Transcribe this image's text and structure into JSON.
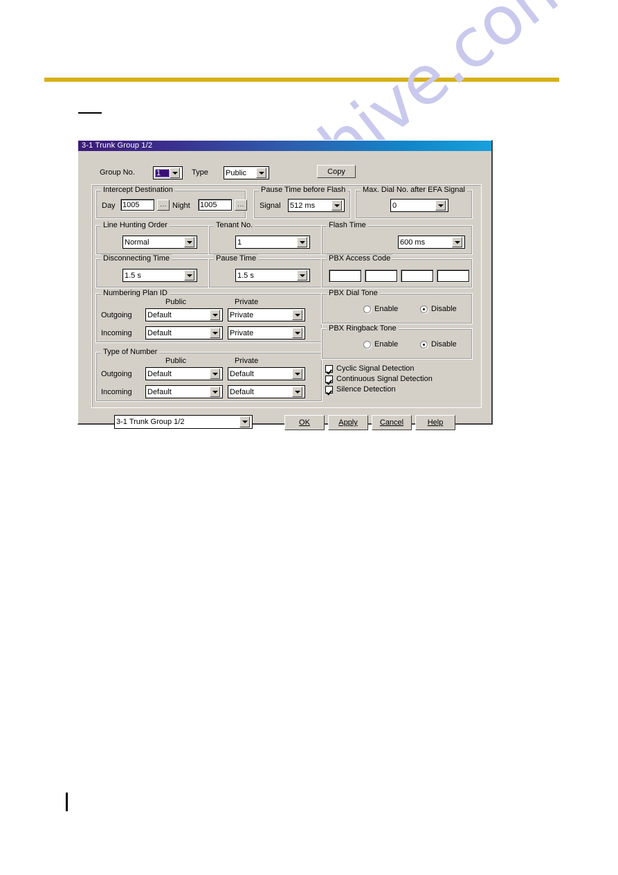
{
  "page": {
    "watermark": "manualshive.com"
  },
  "dialog": {
    "title": "3-1 Trunk Group 1/2",
    "group_no_label": "Group No.",
    "group_no_value": "1",
    "type_label": "Type",
    "type_value": "Public",
    "copy_button": "Copy",
    "intercept": {
      "legend": "Intercept Destination",
      "day_label": "Day",
      "day_value": "1005",
      "day_browse": "...",
      "night_label": "Night",
      "night_value": "1005",
      "night_browse": "..."
    },
    "pause_before_flash": {
      "legend": "Pause Time before Flash",
      "signal_label": "Signal",
      "signal_value": "512 ms"
    },
    "max_dial_efa": {
      "legend": "Max. Dial No. after EFA Signal",
      "value": "0"
    },
    "line_hunting": {
      "legend": "Line Hunting Order",
      "value": "Normal"
    },
    "tenant_no": {
      "legend": "Tenant No.",
      "value": "1"
    },
    "flash_time": {
      "legend": "Flash Time",
      "value": "600 ms"
    },
    "disconnecting_time": {
      "legend": "Disconnecting Time",
      "value": "1.5 s"
    },
    "pause_time": {
      "legend": "Pause Time",
      "value": "1.5 s"
    },
    "pbx_access_code": {
      "legend": "PBX Access Code",
      "values": [
        "",
        "",
        "",
        ""
      ]
    },
    "numbering_plan_id": {
      "legend": "Numbering Plan ID",
      "col_public": "Public",
      "col_private": "Private",
      "row_outgoing": "Outgoing",
      "row_incoming": "Incoming",
      "outgoing_public": "Default",
      "outgoing_private": "Private",
      "incoming_public": "Default",
      "incoming_private": "Private"
    },
    "type_of_number": {
      "legend": "Type of Number",
      "col_public": "Public",
      "col_private": "Private",
      "row_outgoing": "Outgoing",
      "row_incoming": "Incoming",
      "outgoing_public": "Default",
      "outgoing_private": "Default",
      "incoming_public": "Default",
      "incoming_private": "Default"
    },
    "pbx_dial_tone": {
      "legend": "PBX Dial Tone",
      "enable_label": "Enable",
      "disable_label": "Disable",
      "selected": "Disable"
    },
    "pbx_ringback_tone": {
      "legend": "PBX Ringback Tone",
      "enable_label": "Enable",
      "disable_label": "Disable",
      "selected": "Disable"
    },
    "detections": [
      {
        "label": "Cyclic Signal Detection",
        "checked": true
      },
      {
        "label": "Continuous Signal Detection",
        "checked": true
      },
      {
        "label": "Silence Detection",
        "checked": true
      }
    ],
    "footer": {
      "screen_selector": "3-1 Trunk Group 1/2",
      "ok": "OK",
      "apply": "Apply",
      "cancel": "Cancel",
      "help": "Help"
    }
  }
}
